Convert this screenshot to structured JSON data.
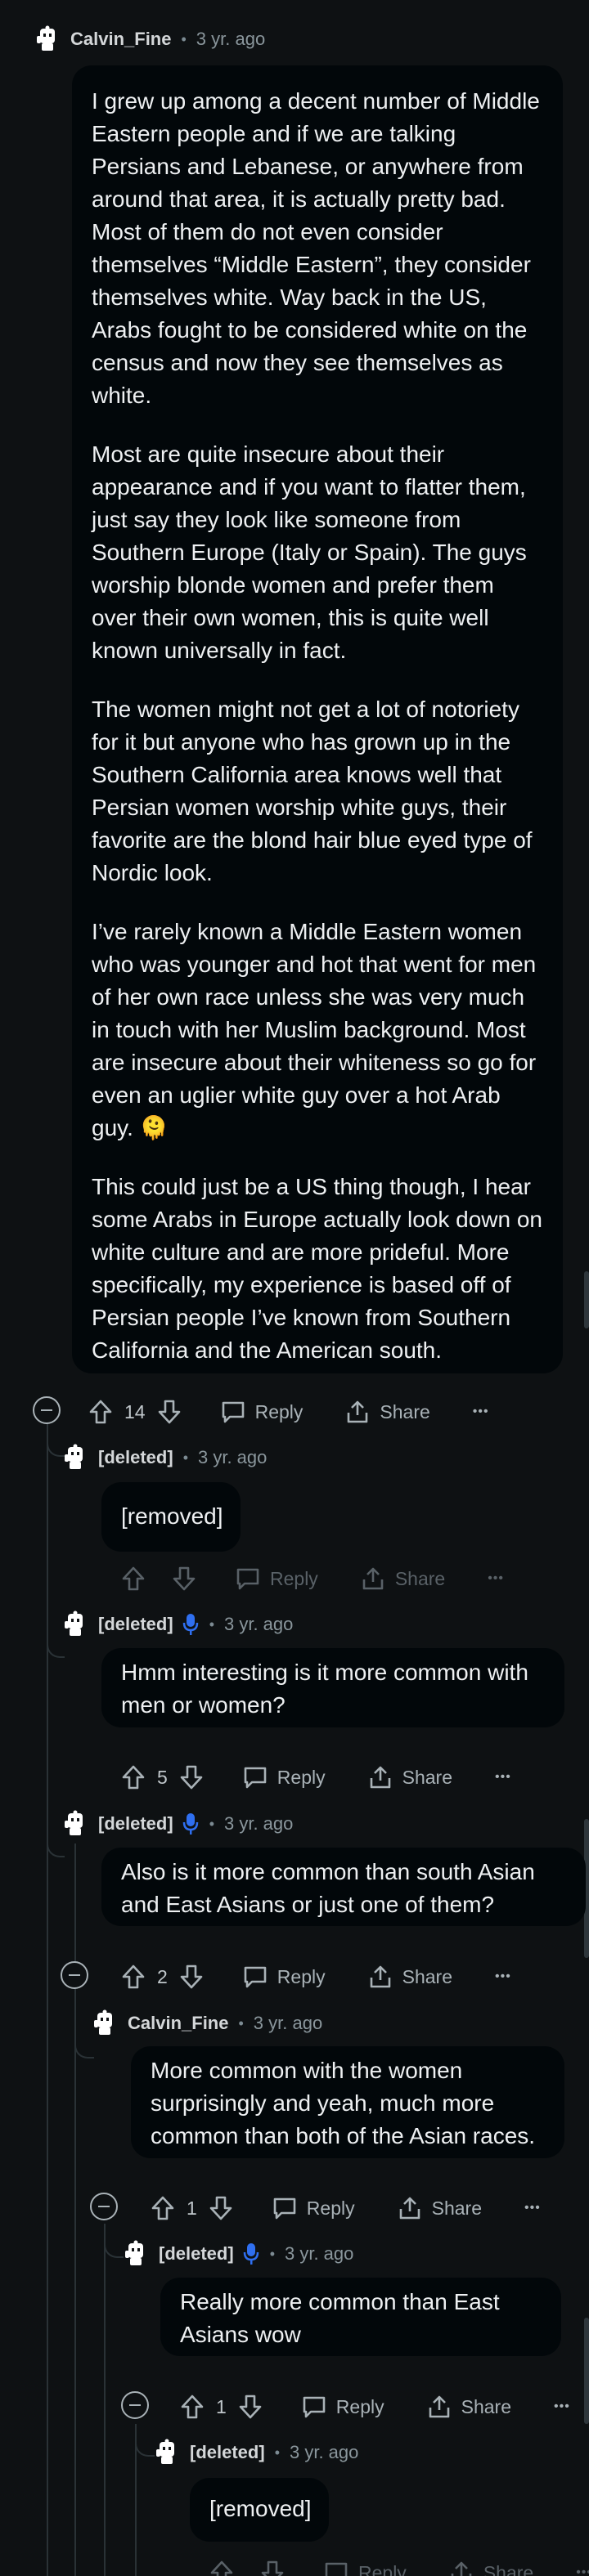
{
  "labels": {
    "reply": "Reply",
    "share": "Share",
    "more": "•••"
  },
  "comments": [
    {
      "username": "Calvin_Fine",
      "time": "3 yr. ago",
      "votes": "14",
      "paragraphs": [
        "I grew up among a decent number of Middle Eastern people and if we are talking Persians and Lebanese, or anywhere from around that area, it is actually pretty bad. Most of them do not even consider themselves “Middle Eastern”, they consider themselves white. Way back in the US, Arabs fought to be considered white on the census and now they see themselves as white.",
        "Most are quite insecure about their appearance and if you want to flatter them, just say they look like someone from Southern Europe (Italy or Spain). The guys worship blonde women and prefer them over their own women, this is quite well known universally in fact.",
        "The women might not get a lot of notoriety for it but anyone who has grown up in the Southern California area knows well that Persian women worship white guys, their favorite are the blond hair blue eyed type of Nordic look.",
        "I’ve rarely known a Middle Eastern women who was younger and hot that went for men of her own race unless she was very much in touch with her Muslim background. Most are insecure about their whiteness so go for even an uglier white guy over a hot Arab guy. 🫠",
        "This could just be a US thing though, I hear some Arabs in Europe actually look down on white culture and are more prideful. More specifically, my experience is based off of Persian people I’ve known from Southern California and the American south."
      ]
    },
    {
      "username": "[deleted]",
      "time": "3 yr. ago",
      "votes": "",
      "paragraphs": [
        "[removed]"
      ]
    },
    {
      "username": "[deleted]",
      "time": "3 yr. ago",
      "votes": "5",
      "paragraphs": [
        "Hmm interesting is it more common with men or women?"
      ]
    },
    {
      "username": "[deleted]",
      "time": "3 yr. ago",
      "votes": "2",
      "paragraphs": [
        "Also is it more common than south Asian and East Asians or just one of them?"
      ]
    },
    {
      "username": "Calvin_Fine",
      "time": "3 yr. ago",
      "votes": "1",
      "paragraphs": [
        "More common with the women surprisingly and yeah, much more common than both of the Asian races."
      ]
    },
    {
      "username": "[deleted]",
      "time": "3 yr. ago",
      "votes": "1",
      "paragraphs": [
        "Really more common than East Asians wow"
      ]
    },
    {
      "username": "[deleted]",
      "time": "3 yr. ago",
      "votes": "",
      "paragraphs": [
        "[removed]"
      ]
    }
  ]
}
